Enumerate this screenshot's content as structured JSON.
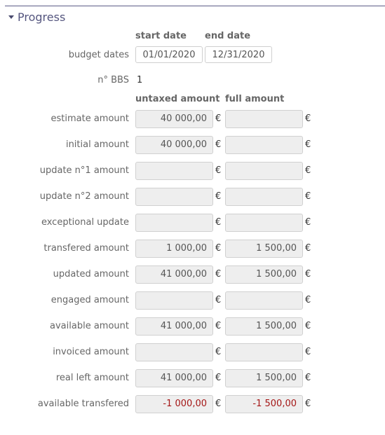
{
  "section": {
    "title": "Progress"
  },
  "columns": {
    "start_date": "start date",
    "end_date": "end date",
    "untaxed": "untaxed amount",
    "full": "full amount"
  },
  "budget_dates": {
    "label": "budget dates",
    "start": "01/01/2020",
    "end": "12/31/2020"
  },
  "bbs": {
    "label": "n° BBS",
    "value": "1"
  },
  "currency": "€",
  "rows": [
    {
      "label": "estimate amount",
      "untaxed": "40 000,00",
      "full": ""
    },
    {
      "label": "initial amount",
      "untaxed": "40 000,00",
      "full": ""
    },
    {
      "label": "update n°1 amount",
      "untaxed": "",
      "full": ""
    },
    {
      "label": "update n°2 amount",
      "untaxed": "",
      "full": ""
    },
    {
      "label": "exceptional update",
      "untaxed": "",
      "full": ""
    },
    {
      "label": "transfered amount",
      "untaxed": "1 000,00",
      "full": "1 500,00"
    },
    {
      "label": "updated amount",
      "untaxed": "41 000,00",
      "full": "1 500,00"
    },
    {
      "label": "engaged amount",
      "untaxed": "",
      "full": ""
    },
    {
      "label": "available amount",
      "untaxed": "41 000,00",
      "full": "1 500,00"
    },
    {
      "label": "invoiced amount",
      "untaxed": "",
      "full": ""
    },
    {
      "label": "real left amount",
      "untaxed": "41 000,00",
      "full": "1 500,00"
    },
    {
      "label": "available transfered",
      "untaxed": "-1 000,00",
      "full": "-1 500,00"
    }
  ],
  "colors": {
    "negative": "#a51717",
    "header_line": "#5b5c86",
    "field_bg": "#eeeeee"
  }
}
